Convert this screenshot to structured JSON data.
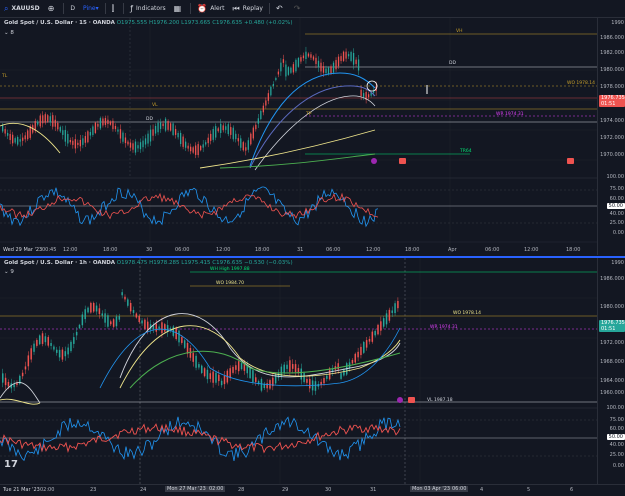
{
  "toolbar": {
    "symbol": "XAUUSD",
    "interval": "D",
    "pine": "Pine",
    "indicators": "Indicators",
    "alert": "Alert",
    "replay": "Replay"
  },
  "top_pane": {
    "title": "Gold Spot / U.S. Dollar · 15 · OANDA",
    "ohlc": "O1975.555 H1976.200 L1973.665 C1976.635 +0.480 (+0.02%)",
    "collapse": "8",
    "price_ticks": [
      "1990",
      "1986.000",
      "1982.000",
      "1980.000",
      "1978.000",
      "1976.000",
      "1974.000",
      "1972.000",
      "1970.000"
    ],
    "price_tag": "1976.735",
    "price_tag_sub": "01:51",
    "osc_ticks": [
      "100.00",
      "75.00",
      "60.00",
      "50.00",
      "40.00",
      "25.00",
      "0.00"
    ],
    "osc_tag": "50.00",
    "time_labels": [
      "Wed 29 Mar '23",
      "00:45",
      "12:00",
      "18:00",
      "30",
      "06:00",
      "12:00",
      "18:00",
      "31",
      "06:00",
      "12:00",
      "18:00",
      "Apr",
      "06:00",
      "12:00",
      "18:00"
    ],
    "levels": {
      "vh": "VH",
      "dd": "DD",
      "wo": "WO 1978.14",
      "vl": "VL",
      "wr": "WR 1974.31",
      "tp": "TP",
      "tl": "TL",
      "dd2": "DD",
      "rh": "TR64"
    }
  },
  "bottom_pane": {
    "title": "Gold Spot / U.S. Dollar · 1h · OANDA",
    "ohlc": "O1978.475 H1978.285 L1975.415 C1976.635 −0.530 (−0.03%)",
    "collapse": "9",
    "price_ticks": [
      "1990",
      "1986.000",
      "1980.000",
      "1976.000",
      "1972.000",
      "1968.000",
      "1964.000",
      "1960.000"
    ],
    "price_tag": "1976.735",
    "price_tag_sub": "01:51",
    "osc_ticks": [
      "100.00",
      "75.00",
      "60.00",
      "50.00",
      "40.00",
      "25.00",
      "0.00"
    ],
    "osc_tag": "50.00",
    "time_labels": [
      "Tue 21 Mar '23",
      "02:00",
      "23",
      "24",
      "Mon 27 Mar '23",
      "02:00",
      "28",
      "29",
      "30",
      "31",
      "Mon 03 Apr '23",
      "06:00",
      "4",
      "5",
      "6"
    ],
    "levels": {
      "wo": "WO 1984.70",
      "wh": "WH High 1997.88",
      "wo2": "WO 1978.14",
      "wr": "WR 1974.31",
      "vl": "VL 1987.18"
    }
  },
  "colors": {
    "up": "#26a69a",
    "down": "#ef5350",
    "bg": "#131722",
    "grid": "#2a2e39",
    "accent": "#2962ff",
    "osc": "#2196f3",
    "osc_signal": "#ef5350"
  }
}
